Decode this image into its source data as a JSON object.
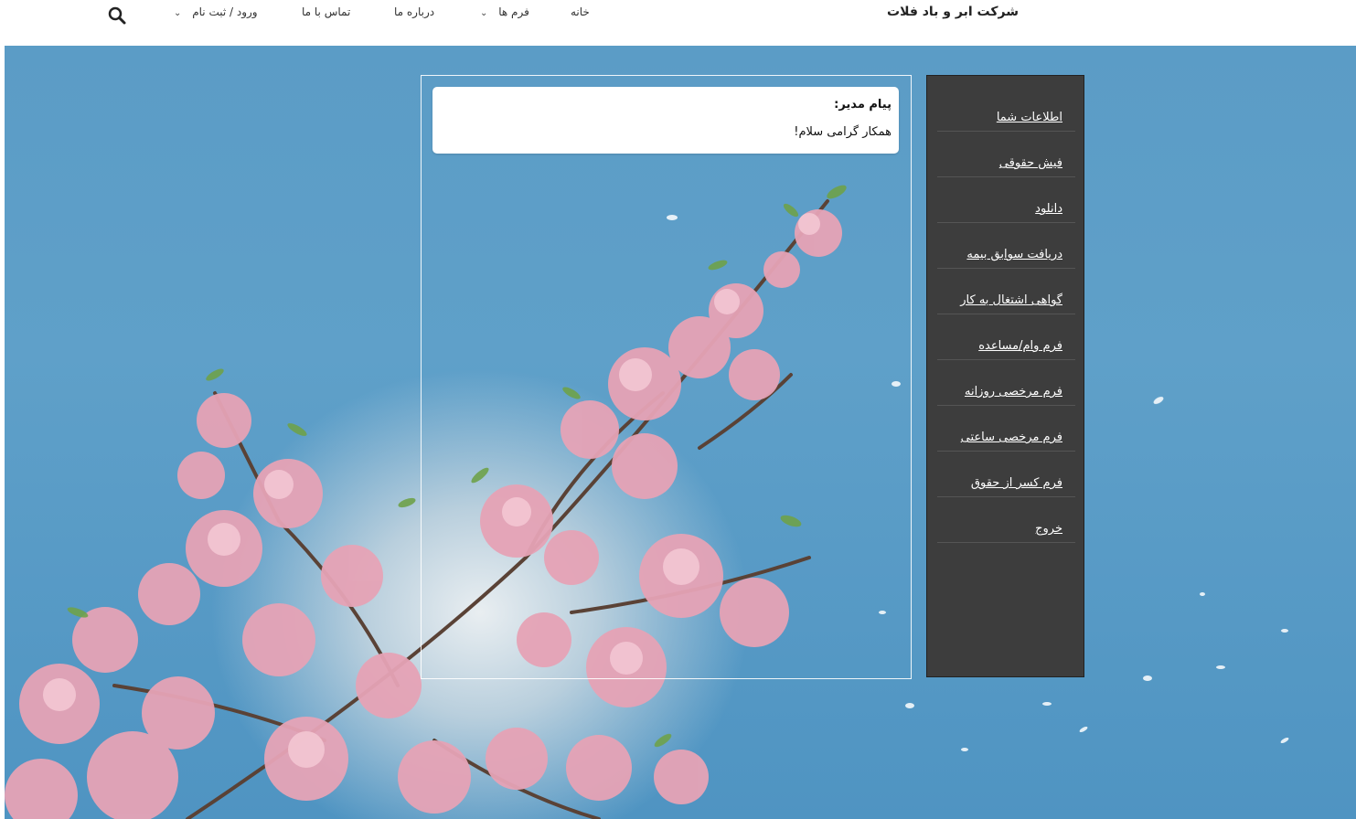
{
  "header": {
    "brand": "شرکت ابر و باد فلات",
    "nav": {
      "home": "خانه",
      "forms": "فرم ها",
      "about": "درباره ما",
      "contact": "تماس با ما",
      "account": "ورود / ثبت نام"
    },
    "icons": {
      "search": "search-icon",
      "dropdown": "chevron-down-icon"
    }
  },
  "message": {
    "title": "پیام مدیر:",
    "body": "همکار گرامی سلام!"
  },
  "sidebar": {
    "items": [
      {
        "label": "اطلاعات شما"
      },
      {
        "label": "فیش حقوقی"
      },
      {
        "label": "دانلود"
      },
      {
        "label": "دریافت سوابق بیمه"
      },
      {
        "label": "گواهی اشتغال به کار"
      },
      {
        "label": "فرم وام/مساعده"
      },
      {
        "label": "فرم مرخصی روزانه"
      },
      {
        "label": "فرم مرخصی ساعتی"
      },
      {
        "label": "فرم کسر از حقوق"
      },
      {
        "label": "خروج"
      }
    ]
  },
  "colors": {
    "sky": "#5b9cc6",
    "sidebar_bg": "#3d3d3d",
    "blossom": "#e6a3b6"
  }
}
